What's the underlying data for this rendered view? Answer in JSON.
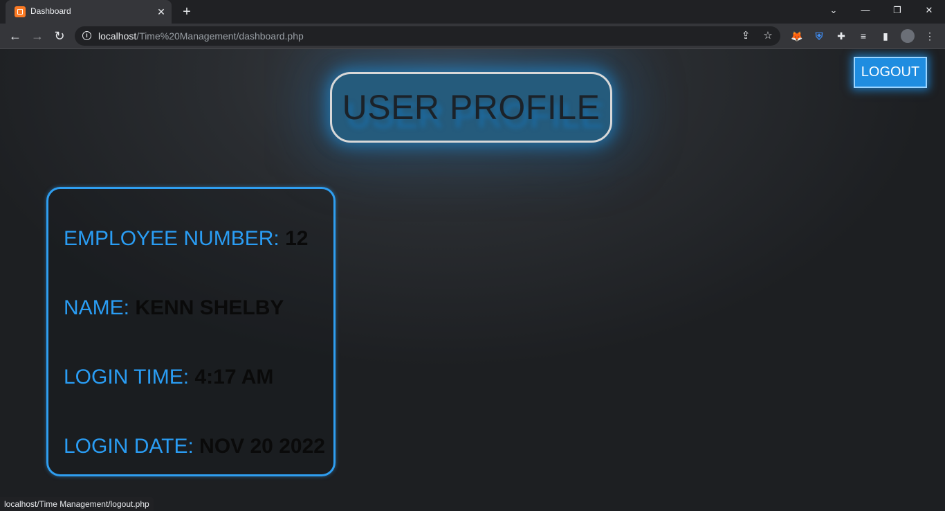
{
  "browser": {
    "tab_title": "Dashboard",
    "tab_close": "✕",
    "new_tab": "+",
    "url_host": "localhost",
    "url_path": "/Time%20Management/dashboard.php",
    "status_url": "localhost/Time Management/logout.php"
  },
  "header": {
    "title": "USER PROFILE",
    "logout_label": "LOGOUT"
  },
  "profile": {
    "rows": [
      {
        "label": "EMPLOYEE NUMBER:",
        "value": "12"
      },
      {
        "label": "NAME:",
        "value": "KENN SHELBY"
      },
      {
        "label": "LOGIN TIME:",
        "value": "4:17 AM"
      },
      {
        "label": "LOGIN DATE:",
        "value": "NOV 20 2022"
      }
    ]
  },
  "colors": {
    "accent": "#2a9df4",
    "title_fill": "#255b7c",
    "logout_fill": "#1f8de0",
    "background": "#202124"
  }
}
